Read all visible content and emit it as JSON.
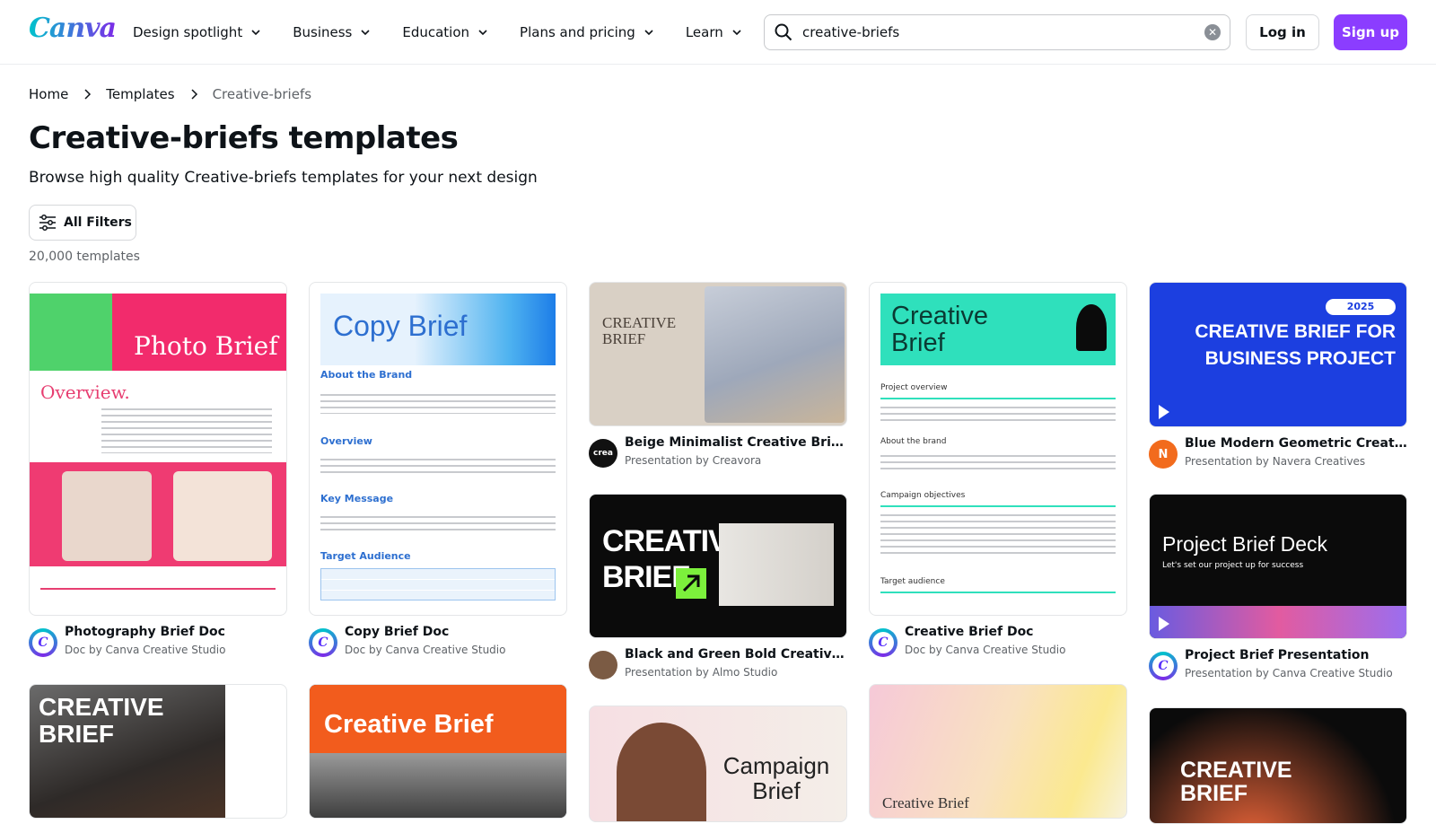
{
  "header": {
    "logo": "Canva",
    "nav": [
      {
        "label": "Design spotlight"
      },
      {
        "label": "Business"
      },
      {
        "label": "Education"
      },
      {
        "label": "Plans and pricing"
      },
      {
        "label": "Learn"
      }
    ],
    "search_value": "creative-briefs",
    "login_label": "Log in",
    "signup_label": "Sign up"
  },
  "breadcrumb": [
    "Home",
    "Templates",
    "Creative-briefs"
  ],
  "page": {
    "title": "Creative-briefs templates",
    "subtitle": "Browse high quality Creative-briefs templates for your next design",
    "filters_label": "All Filters",
    "count": "20,000 templates"
  },
  "cards": [
    {
      "title": "Photography Brief Doc",
      "subtitle": "Doc by Canva Creative Studio",
      "thumb_text": "Photo Brief",
      "thumb_sub": "Overview.",
      "avatar": "canva"
    },
    {
      "title": "Copy Brief Doc",
      "subtitle": "Doc by Canva Creative Studio",
      "thumb_text": "Copy Brief",
      "thumb_sections": [
        "About the Brand",
        "Overview",
        "Key Message",
        "Target Audience"
      ],
      "avatar": "canva"
    },
    {
      "title": "Beige Minimalist Creative Brief Pre...",
      "subtitle": "Presentation by Creavora",
      "thumb_text": "CREATIVE BRIEF",
      "avatar": "creavora"
    },
    {
      "title": "Creative Brief Doc",
      "subtitle": "Doc by Canva Creative Studio",
      "thumb_text": "Creative Brief",
      "thumb_sections": [
        "Project overview",
        "About the brand",
        "Campaign objectives",
        "Target audience"
      ],
      "avatar": "canva"
    },
    {
      "title": "Blue Modern Geometric Creative B...",
      "subtitle": "Presentation by Navera Creatives",
      "thumb_text": "CREATIVE BRIEF FOR BUSINESS PROJECT",
      "thumb_badge": "2025",
      "avatar": "N"
    },
    {
      "title": "Black and Green Bold Creative Bri...",
      "subtitle": "Presentation by Almo Studio",
      "thumb_text": "CREATIVE BRIEF",
      "avatar": "almo"
    },
    {
      "title": "Project Brief Presentation",
      "subtitle": "Presentation by Canva Creative Studio",
      "thumb_text": "Project Brief Deck",
      "thumb_sub": "Let's set our project up for success",
      "avatar": "canva"
    },
    {
      "thumb_text": "CREATIVE BRIEF"
    },
    {
      "thumb_text": "Creative Brief"
    },
    {
      "thumb_text": "Campaign Brief"
    },
    {
      "thumb_text": "Creative Brief"
    },
    {
      "thumb_text": "CREATIVE BRIEF"
    }
  ],
  "colors": {
    "accent": "#8b3dff",
    "text": "#0e1318",
    "muted": "#5f6368"
  }
}
